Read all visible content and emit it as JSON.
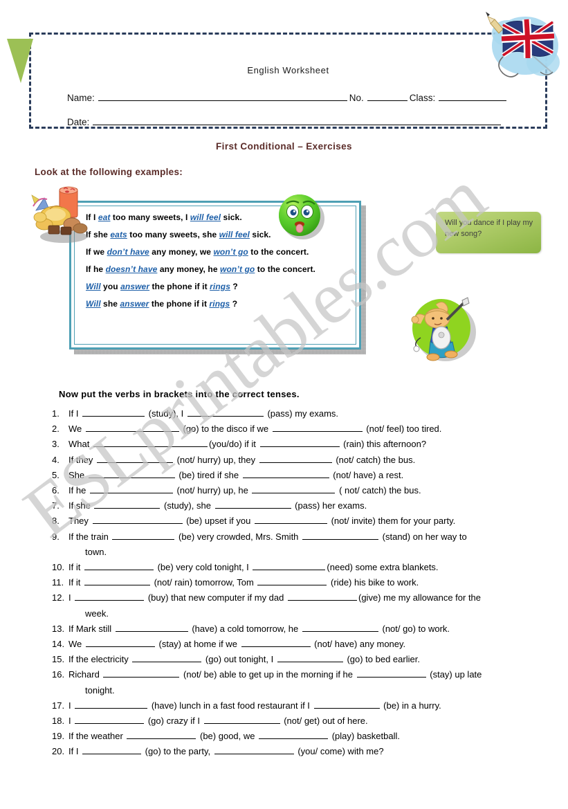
{
  "header": {
    "worksheet_title": "English Worksheet",
    "name_label": "Name:",
    "no_label": "No.",
    "class_label": "Class:",
    "date_label": "Date:",
    "flag_icon": "uk-flag-icon"
  },
  "section": {
    "title": "First Conditional – Exercises",
    "examples_heading": "Look at the following examples:"
  },
  "examples": {
    "lines": [
      {
        "pre": "If I ",
        "v1": "eat",
        "mid": " too many sweets, I ",
        "v2": "will feel",
        "post": " sick."
      },
      {
        "pre": "If she ",
        "v1": "eats",
        "mid": " too many sweets, she ",
        "v2": "will feel",
        "post": " sick."
      },
      {
        "pre": "If we ",
        "v1": "don’t have",
        "mid": " any money, we ",
        "v2": "won’t go",
        "post": " to the concert."
      },
      {
        "pre": "If he ",
        "v1": "doesn’t have",
        "mid": " any money, he ",
        "v2": "won’t go",
        "post": " to the concert."
      },
      {
        "pre": "",
        "v1": "Will",
        "mid": " you ",
        "v2": "answer",
        "post": " the phone if it ",
        "v3": "rings",
        "tail": " ?"
      },
      {
        "pre": "",
        "v1": "Will",
        "mid": " she ",
        "v2": "answer",
        "post": " the phone if it ",
        "v3": "rings",
        "tail": " ?"
      }
    ]
  },
  "speech_bubble": {
    "text": "Will you dance if I play my new song?"
  },
  "clipart": {
    "sweets": "sweets-pile-icon",
    "smiley": "sick-green-smiley-icon",
    "jester": "jester-guitar-icon"
  },
  "exercise": {
    "heading": "Now put the verbs in brackets into the correct tenses.",
    "items": [
      {
        "n": "1.",
        "parts": [
          "If I ",
          "BLANK90",
          " (study), I ",
          "BLANK110",
          " (pass) my exams."
        ]
      },
      {
        "n": "2.",
        "parts": [
          "We ",
          "BLANK135",
          " (go) to the disco if we ",
          "BLANK130",
          " (not/ feel) too tired."
        ]
      },
      {
        "n": "3.",
        "parts": [
          "What ",
          "BLANK165",
          "(you/do) if it ",
          "BLANK115",
          " (rain) this afternoon?"
        ]
      },
      {
        "n": "4.",
        "parts": [
          "If they ",
          "BLANK110",
          " (not/ hurry) up, they ",
          "BLANK105",
          " (not/ catch) the bus."
        ]
      },
      {
        "n": "5.",
        "parts": [
          "She ",
          "BLANK125",
          " (be) tired if she ",
          "BLANK125",
          " (not/ have) a rest."
        ]
      },
      {
        "n": "6.",
        "parts": [
          "If he ",
          "BLANK120",
          " (not/ hurry) up, he ",
          "BLANK120",
          " ( not/ catch) the bus."
        ]
      },
      {
        "n": "7.",
        "parts": [
          "If she ",
          "BLANK95",
          " (study), she ",
          "BLANK110",
          " (pass) her exams."
        ]
      },
      {
        "n": "8.",
        "parts": [
          "They ",
          "BLANK130",
          " (be) upset if you ",
          "BLANK105",
          " (not/ invite) them for your party."
        ]
      },
      {
        "n": "9.",
        "parts": [
          "If the train ",
          "BLANK90",
          " (be) very crowded, Mrs. Smith ",
          "BLANK110",
          " (stand) on her way to"
        ],
        "cont": "town."
      },
      {
        "n": "10.",
        "parts": [
          "If it ",
          "BLANK100",
          " (be) very cold tonight, I ",
          "BLANK105",
          "(need) some extra blankets."
        ]
      },
      {
        "n": "11.",
        "parts": [
          "If it ",
          "BLANK95",
          " (not/ rain) tomorrow, Tom ",
          "BLANK100",
          " (ride) his bike to work."
        ]
      },
      {
        "n": "12.",
        "parts": [
          "I ",
          "BLANK100",
          " (buy) that new computer if my dad ",
          "BLANK100",
          "(give) me my allowance for the"
        ],
        "cont": "week."
      },
      {
        "n": "13.",
        "parts": [
          "If Mark still ",
          "BLANK105",
          " (have) a cold tomorrow, he ",
          "BLANK110",
          " (not/ go) to work."
        ]
      },
      {
        "n": "14.",
        "parts": [
          "We ",
          "BLANK100",
          " (stay) at home if we ",
          "BLANK100",
          " (not/ have) any money."
        ]
      },
      {
        "n": "15.",
        "parts": [
          "If the electricity ",
          "BLANK100",
          " (go) out tonight, I ",
          "BLANK95",
          " (go) to bed earlier."
        ]
      },
      {
        "n": "16.",
        "parts": [
          "Richard ",
          "BLANK110",
          " (not/ be) able to get up in the morning if he ",
          "BLANK100",
          " (stay) up late"
        ],
        "cont": "tonight."
      },
      {
        "n": "17.",
        "parts": [
          "I ",
          "BLANK105",
          " (have) lunch in a fast food restaurant if I ",
          "BLANK95",
          " (be) in a hurry."
        ]
      },
      {
        "n": "18.",
        "parts": [
          "I ",
          "BLANK100",
          " (go) crazy if I ",
          "BLANK110",
          " (not/ get) out of here."
        ]
      },
      {
        "n": "19.",
        "parts": [
          "If the weather ",
          "BLANK100",
          " (be) good, we ",
          "BLANK100",
          " (play) basketball."
        ]
      },
      {
        "n": "20.",
        "parts": [
          "If I ",
          "BLANK85",
          " (go) to the party, ",
          "BLANK115",
          " (you/ come) with me?"
        ]
      }
    ]
  },
  "watermark": {
    "text": "ESLprintables.com"
  }
}
